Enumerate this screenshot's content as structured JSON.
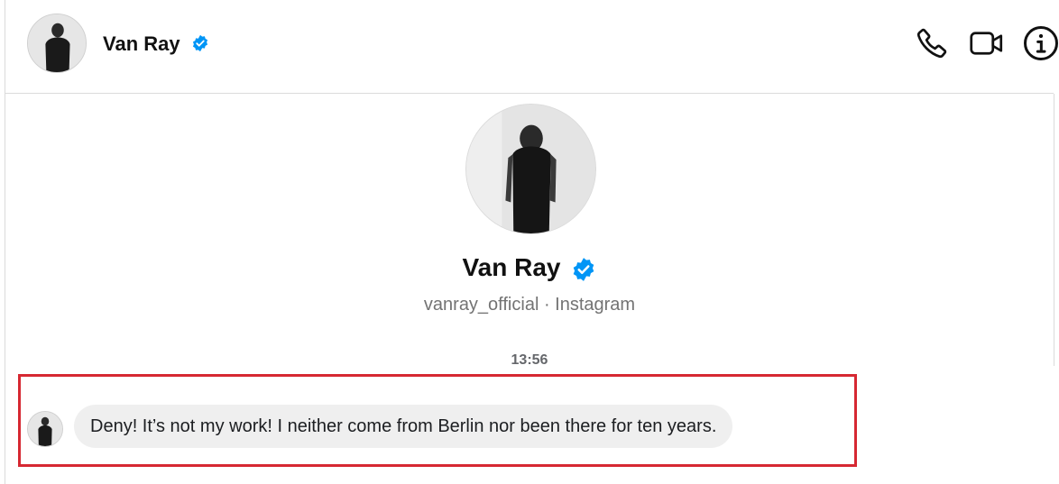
{
  "header": {
    "name": "Van Ray",
    "verified_icon": "verified-badge-icon",
    "actions": [
      {
        "name": "phone-icon"
      },
      {
        "name": "video-camera-icon"
      },
      {
        "name": "info-icon"
      }
    ]
  },
  "profile": {
    "name": "Van Ray",
    "subtitle": "vanray_official · Instagram"
  },
  "conversation": {
    "timestamp": "13:56",
    "messages": [
      {
        "sender": "Van Ray",
        "text": "Deny! It’s not my work! I neither come from Berlin nor been there for ten years."
      }
    ]
  },
  "colors": {
    "verified": "#0095f6",
    "bubble": "#efefef",
    "highlight": "#d62832",
    "divider": "#dbdbdb"
  }
}
